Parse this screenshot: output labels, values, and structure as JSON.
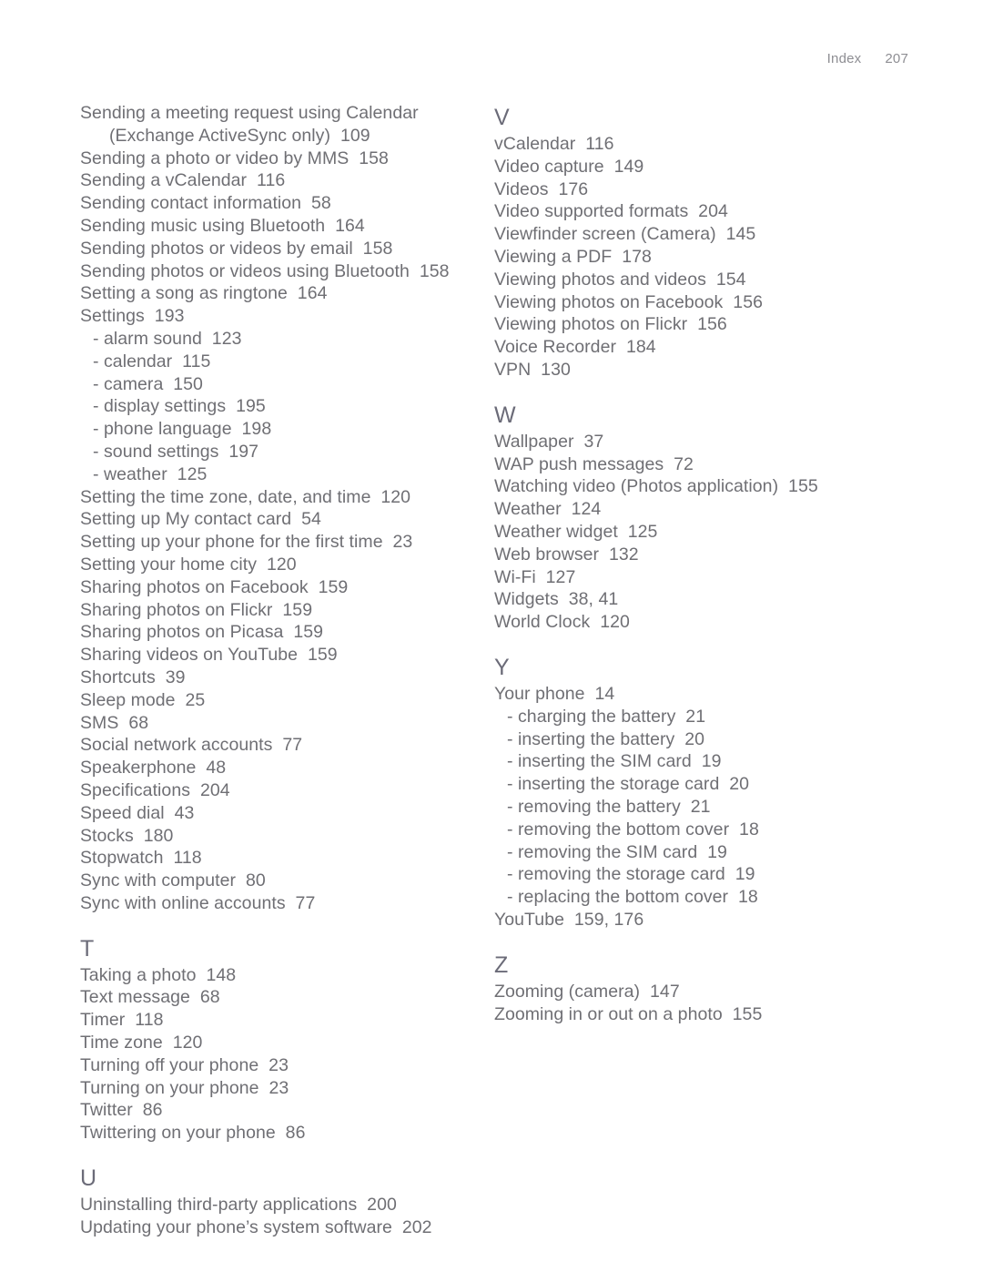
{
  "running_head": {
    "label": "Index",
    "page_number": "207"
  },
  "columns": [
    {
      "name": "left-column",
      "sections": [
        {
          "letter": "",
          "entries": [
            {
              "text": "Sending a meeting request using Calendar",
              "level": "top"
            },
            {
              "text": "(Exchange ActiveSync only)  109",
              "level": "cont"
            },
            {
              "text": "Sending a photo or video by MMS  158",
              "level": "top"
            },
            {
              "text": "Sending a vCalendar  116",
              "level": "top"
            },
            {
              "text": "Sending contact information  58",
              "level": "top"
            },
            {
              "text": "Sending music using Bluetooth  164",
              "level": "top"
            },
            {
              "text": "Sending photos or videos by email  158",
              "level": "top"
            },
            {
              "text": "Sending photos or videos using Bluetooth  158",
              "level": "top"
            },
            {
              "text": "Setting a song as ringtone  164",
              "level": "top"
            },
            {
              "text": "Settings  193",
              "level": "top"
            },
            {
              "text": "- alarm sound  123",
              "level": "sub"
            },
            {
              "text": "- calendar  115",
              "level": "sub"
            },
            {
              "text": "- camera  150",
              "level": "sub"
            },
            {
              "text": "- display settings  195",
              "level": "sub"
            },
            {
              "text": "- phone language  198",
              "level": "sub"
            },
            {
              "text": "- sound settings  197",
              "level": "sub"
            },
            {
              "text": "- weather  125",
              "level": "sub"
            },
            {
              "text": "Setting the time zone, date, and time  120",
              "level": "top"
            },
            {
              "text": "Setting up My contact card  54",
              "level": "top"
            },
            {
              "text": "Setting up your phone for the first time  23",
              "level": "top"
            },
            {
              "text": "Setting your home city  120",
              "level": "top"
            },
            {
              "text": "Sharing photos on Facebook  159",
              "level": "top"
            },
            {
              "text": "Sharing photos on Flickr  159",
              "level": "top"
            },
            {
              "text": "Sharing photos on Picasa  159",
              "level": "top"
            },
            {
              "text": "Sharing videos on YouTube  159",
              "level": "top"
            },
            {
              "text": "Shortcuts  39",
              "level": "top"
            },
            {
              "text": "Sleep mode  25",
              "level": "top"
            },
            {
              "text": "SMS  68",
              "level": "top"
            },
            {
              "text": "Social network accounts  77",
              "level": "top"
            },
            {
              "text": "Speakerphone  48",
              "level": "top"
            },
            {
              "text": "Specifications  204",
              "level": "top"
            },
            {
              "text": "Speed dial  43",
              "level": "top"
            },
            {
              "text": "Stocks  180",
              "level": "top"
            },
            {
              "text": "Stopwatch  118",
              "level": "top"
            },
            {
              "text": "Sync with computer  80",
              "level": "top"
            },
            {
              "text": "Sync with online accounts  77",
              "level": "top"
            }
          ]
        },
        {
          "letter": "T",
          "entries": [
            {
              "text": "Taking a photo  148",
              "level": "top"
            },
            {
              "text": "Text message  68",
              "level": "top"
            },
            {
              "text": "Timer  118",
              "level": "top"
            },
            {
              "text": "Time zone  120",
              "level": "top"
            },
            {
              "text": "Turning off your phone  23",
              "level": "top"
            },
            {
              "text": "Turning on your phone  23",
              "level": "top"
            },
            {
              "text": "Twitter  86",
              "level": "top"
            },
            {
              "text": "Twittering on your phone  86",
              "level": "top"
            }
          ]
        },
        {
          "letter": "U",
          "entries": [
            {
              "text": "Uninstalling third-party applications  200",
              "level": "top"
            },
            {
              "text": "Updating your phone’s system software  202",
              "level": "top"
            }
          ]
        }
      ]
    },
    {
      "name": "right-column",
      "sections": [
        {
          "letter": "V",
          "entries": [
            {
              "text": "vCalendar  116",
              "level": "top"
            },
            {
              "text": "Video capture  149",
              "level": "top"
            },
            {
              "text": "Videos  176",
              "level": "top"
            },
            {
              "text": "Video supported formats  204",
              "level": "top"
            },
            {
              "text": "Viewfinder screen (Camera)  145",
              "level": "top"
            },
            {
              "text": "Viewing a PDF  178",
              "level": "top"
            },
            {
              "text": "Viewing photos and videos  154",
              "level": "top"
            },
            {
              "text": "Viewing photos on Facebook  156",
              "level": "top"
            },
            {
              "text": "Viewing photos on Flickr  156",
              "level": "top"
            },
            {
              "text": "Voice Recorder  184",
              "level": "top"
            },
            {
              "text": "VPN  130",
              "level": "top"
            }
          ]
        },
        {
          "letter": "W",
          "entries": [
            {
              "text": "Wallpaper  37",
              "level": "top"
            },
            {
              "text": "WAP push messages  72",
              "level": "top"
            },
            {
              "text": "Watching video (Photos application)  155",
              "level": "top"
            },
            {
              "text": "Weather  124",
              "level": "top"
            },
            {
              "text": "Weather widget  125",
              "level": "top"
            },
            {
              "text": "Web browser  132",
              "level": "top"
            },
            {
              "text": "Wi-Fi  127",
              "level": "top"
            },
            {
              "text": "Widgets  38, 41",
              "level": "top"
            },
            {
              "text": "World Clock  120",
              "level": "top"
            }
          ]
        },
        {
          "letter": "Y",
          "entries": [
            {
              "text": "Your phone  14",
              "level": "top"
            },
            {
              "text": "- charging the battery  21",
              "level": "sub"
            },
            {
              "text": "- inserting the battery  20",
              "level": "sub"
            },
            {
              "text": "- inserting the SIM card  19",
              "level": "sub"
            },
            {
              "text": "- inserting the storage card  20",
              "level": "sub"
            },
            {
              "text": "- removing the battery  21",
              "level": "sub"
            },
            {
              "text": "- removing the bottom cover  18",
              "level": "sub"
            },
            {
              "text": "- removing the SIM card  19",
              "level": "sub"
            },
            {
              "text": "- removing the storage card  19",
              "level": "sub"
            },
            {
              "text": "- replacing the bottom cover  18",
              "level": "sub"
            },
            {
              "text": "YouTube  159, 176",
              "level": "top"
            }
          ]
        },
        {
          "letter": "Z",
          "entries": [
            {
              "text": "Zooming (camera)  147",
              "level": "top"
            },
            {
              "text": "Zooming in or out on a photo  155",
              "level": "top"
            }
          ]
        }
      ]
    }
  ]
}
